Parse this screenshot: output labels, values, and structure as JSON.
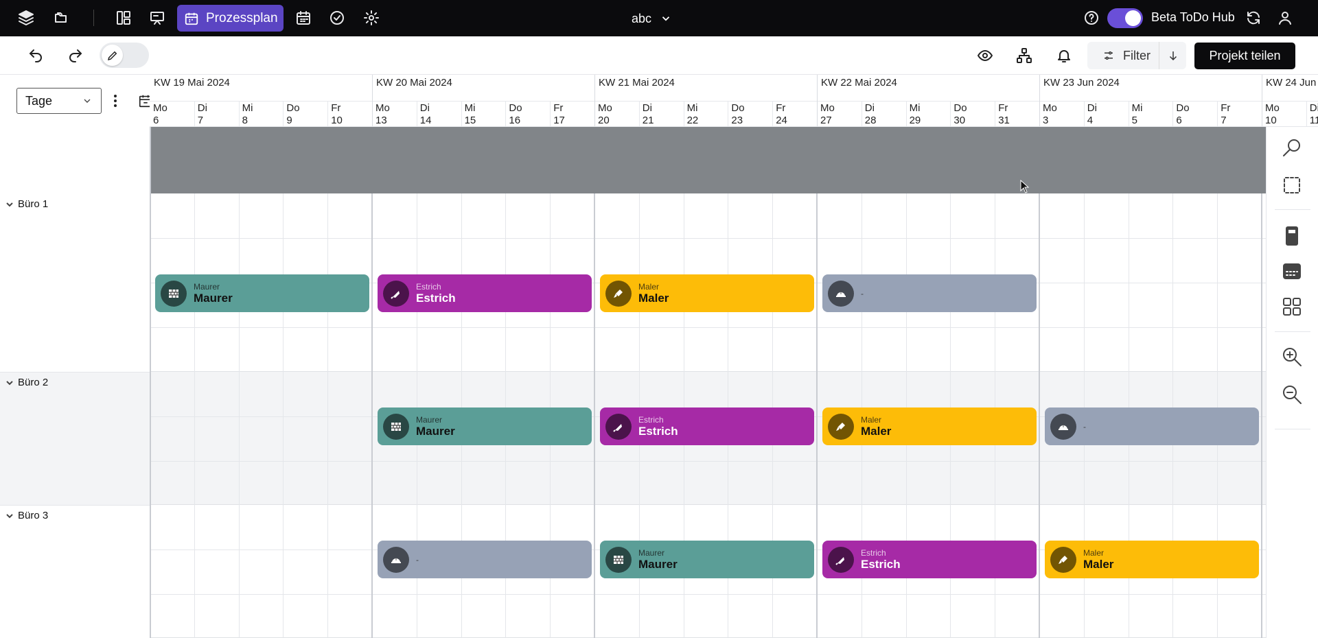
{
  "topbar": {
    "icons": [
      "layers-icon",
      "folders-icon",
      "dashboard-icon",
      "presentation-icon",
      "calendar-icon",
      "check-circle-icon",
      "gear-icon"
    ],
    "active_tab": "Prozessplan",
    "project_name": "abc",
    "beta_label": "Beta ToDo Hub",
    "toggle_on": true
  },
  "toolbar": {
    "filter_label": "Filter",
    "share_label": "Projekt teilen"
  },
  "view_select": {
    "value": "Tage"
  },
  "timeline": {
    "weeks": [
      "KW 19 Mai 2024",
      "KW 20 Mai 2024",
      "KW 21 Mai 2024",
      "KW 22 Mai 2024",
      "KW 23 Jun 2024",
      "KW 24 Jun"
    ],
    "days": [
      {
        "wd": "Mo",
        "d": "6"
      },
      {
        "wd": "Di",
        "d": "7"
      },
      {
        "wd": "Mi",
        "d": "8"
      },
      {
        "wd": "Do",
        "d": "9"
      },
      {
        "wd": "Fr",
        "d": "10"
      },
      {
        "wd": "Mo",
        "d": "13"
      },
      {
        "wd": "Di",
        "d": "14"
      },
      {
        "wd": "Mi",
        "d": "15"
      },
      {
        "wd": "Do",
        "d": "16"
      },
      {
        "wd": "Fr",
        "d": "17"
      },
      {
        "wd": "Mo",
        "d": "20"
      },
      {
        "wd": "Di",
        "d": "21"
      },
      {
        "wd": "Mi",
        "d": "22"
      },
      {
        "wd": "Do",
        "d": "23"
      },
      {
        "wd": "Fr",
        "d": "24"
      },
      {
        "wd": "Mo",
        "d": "27"
      },
      {
        "wd": "Di",
        "d": "28"
      },
      {
        "wd": "Mi",
        "d": "29"
      },
      {
        "wd": "Do",
        "d": "30"
      },
      {
        "wd": "Fr",
        "d": "31"
      },
      {
        "wd": "Mo",
        "d": "3"
      },
      {
        "wd": "Di",
        "d": "4"
      },
      {
        "wd": "Mi",
        "d": "5"
      },
      {
        "wd": "Do",
        "d": "6"
      },
      {
        "wd": "Fr",
        "d": "7"
      },
      {
        "wd": "Mo",
        "d": "10"
      },
      {
        "wd": "Di",
        "d": "11"
      }
    ]
  },
  "groups": [
    {
      "label": "Büro 1",
      "tasks": [
        {
          "week": 0,
          "type": "Maurer",
          "title": "Maurer",
          "color": "#5b9e97",
          "text": "#111",
          "icon": "brick-wall-icon"
        },
        {
          "week": 1,
          "type": "Estrich",
          "title": "Estrich",
          "color": "#a62aa6",
          "text": "#fff",
          "icon": "trowel-icon"
        },
        {
          "week": 2,
          "type": "Maler",
          "title": "Maler",
          "color": "#fdbc08",
          "text": "#111",
          "icon": "paint-brush-icon"
        },
        {
          "week": 3,
          "type": "-",
          "title": "",
          "color": "#97a2b6",
          "text": "#222",
          "icon": "hard-hat-icon"
        }
      ]
    },
    {
      "label": "Büro 2",
      "tasks": [
        {
          "week": 1,
          "type": "Maurer",
          "title": "Maurer",
          "color": "#5b9e97",
          "text": "#111",
          "icon": "brick-wall-icon"
        },
        {
          "week": 2,
          "type": "Estrich",
          "title": "Estrich",
          "color": "#a62aa6",
          "text": "#fff",
          "icon": "trowel-icon"
        },
        {
          "week": 3,
          "type": "Maler",
          "title": "Maler",
          "color": "#fdbc08",
          "text": "#111",
          "icon": "paint-brush-icon"
        },
        {
          "week": 4,
          "type": "-",
          "title": "",
          "color": "#97a2b6",
          "text": "#222",
          "icon": "hard-hat-icon"
        }
      ]
    },
    {
      "label": "Büro 3",
      "tasks": [
        {
          "week": 1,
          "type": "-",
          "title": "",
          "color": "#97a2b6",
          "text": "#222",
          "icon": "hard-hat-icon"
        },
        {
          "week": 2,
          "type": "Maurer",
          "title": "Maurer",
          "color": "#5b9e97",
          "text": "#111",
          "icon": "brick-wall-icon"
        },
        {
          "week": 3,
          "type": "Estrich",
          "title": "Estrich",
          "color": "#a62aa6",
          "text": "#fff",
          "icon": "trowel-icon"
        },
        {
          "week": 4,
          "type": "Maler",
          "title": "Maler",
          "color": "#fdbc08",
          "text": "#111",
          "icon": "paint-brush-icon"
        }
      ]
    }
  ],
  "right_panel": {
    "icons": [
      "search-icon",
      "selection-icon",
      "calculator-icon",
      "calendar-grid-icon",
      "layout-grid-icon",
      "zoom-in-icon",
      "zoom-out-icon"
    ]
  }
}
